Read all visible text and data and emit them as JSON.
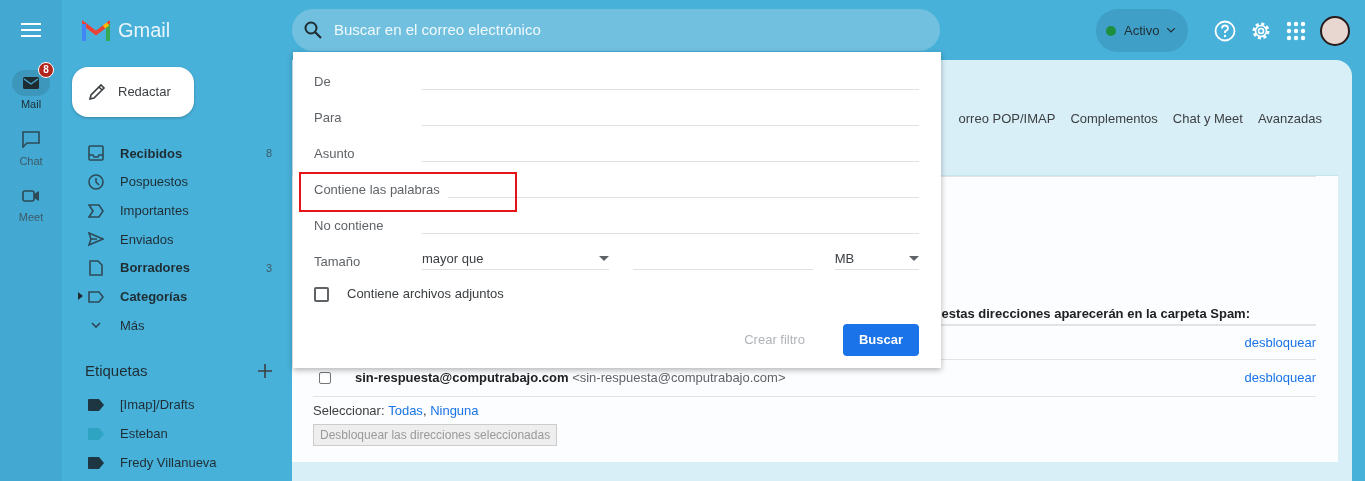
{
  "rail": {
    "items": [
      {
        "kind": "mail",
        "label": "Mail",
        "selected": true,
        "badge": "8"
      },
      {
        "kind": "chat",
        "label": "Chat",
        "selected": false
      },
      {
        "kind": "meet",
        "label": "Meet",
        "selected": false
      }
    ]
  },
  "app": {
    "name": "Gmail"
  },
  "search": {
    "placeholder": "Buscar en el correo electrónico"
  },
  "status": {
    "label": "Activo"
  },
  "compose": {
    "label": "Redactar"
  },
  "folders": [
    {
      "kind": "inbox",
      "label": "Recibidos",
      "count": "8",
      "unread": true
    },
    {
      "kind": "clock",
      "label": "Pospuestos",
      "unread": false
    },
    {
      "kind": "important",
      "label": "Importantes",
      "unread": false
    },
    {
      "kind": "sent",
      "label": "Enviados",
      "unread": false
    },
    {
      "kind": "draft",
      "label": "Borradores",
      "count": "3",
      "unread": true
    },
    {
      "kind": "category",
      "label": "Categorías",
      "unread": true
    },
    {
      "kind": "more",
      "label": "Más",
      "unread": false
    }
  ],
  "labels_title": "Etiquetas",
  "labels": [
    {
      "label": "[Imap]/Drafts",
      "color": "#1d3642"
    },
    {
      "label": "Esteban",
      "color": "#2ea4c2"
    },
    {
      "label": "Fredy Villanueva",
      "color": "#1d3642"
    }
  ],
  "settings_tabs": [
    "orreo POP/IMAP",
    "Complementos",
    "Chat y Meet",
    "Avanzadas"
  ],
  "blocked": {
    "notice": "estas direcciones aparecerán en la carpeta Spam:",
    "rows": [
      {
        "action": "desbloquear"
      },
      {
        "name": "sin-respuesta@computrabajo.com",
        "email": "<sin-respuesta@computrabajo.com>",
        "checked": false,
        "action": "desbloquear"
      }
    ],
    "select_label": "Seleccionar:",
    "select_links": [
      "Todas",
      "Ninguna"
    ],
    "separator": ",",
    "unblock_button": {
      "label": "Desbloquear las direcciones seleccionadas",
      "disabled": true
    }
  },
  "search_options": {
    "fields": [
      {
        "label": "De",
        "highlighted": false
      },
      {
        "label": "Para",
        "highlighted": false
      },
      {
        "label": "Asunto",
        "highlighted": false
      },
      {
        "label": "Contiene las palabras",
        "highlighted": true
      },
      {
        "label": "No contiene",
        "highlighted": false
      }
    ],
    "size": {
      "label": "Tamaño",
      "comparator": "mayor que",
      "unit": "MB"
    },
    "attachment": {
      "label": "Contiene archivos adjuntos",
      "checked": false
    },
    "buttons": [
      {
        "label": "Crear filtro",
        "primary": false,
        "disabled": true
      },
      {
        "label": "Buscar",
        "primary": true,
        "disabled": false
      }
    ]
  }
}
